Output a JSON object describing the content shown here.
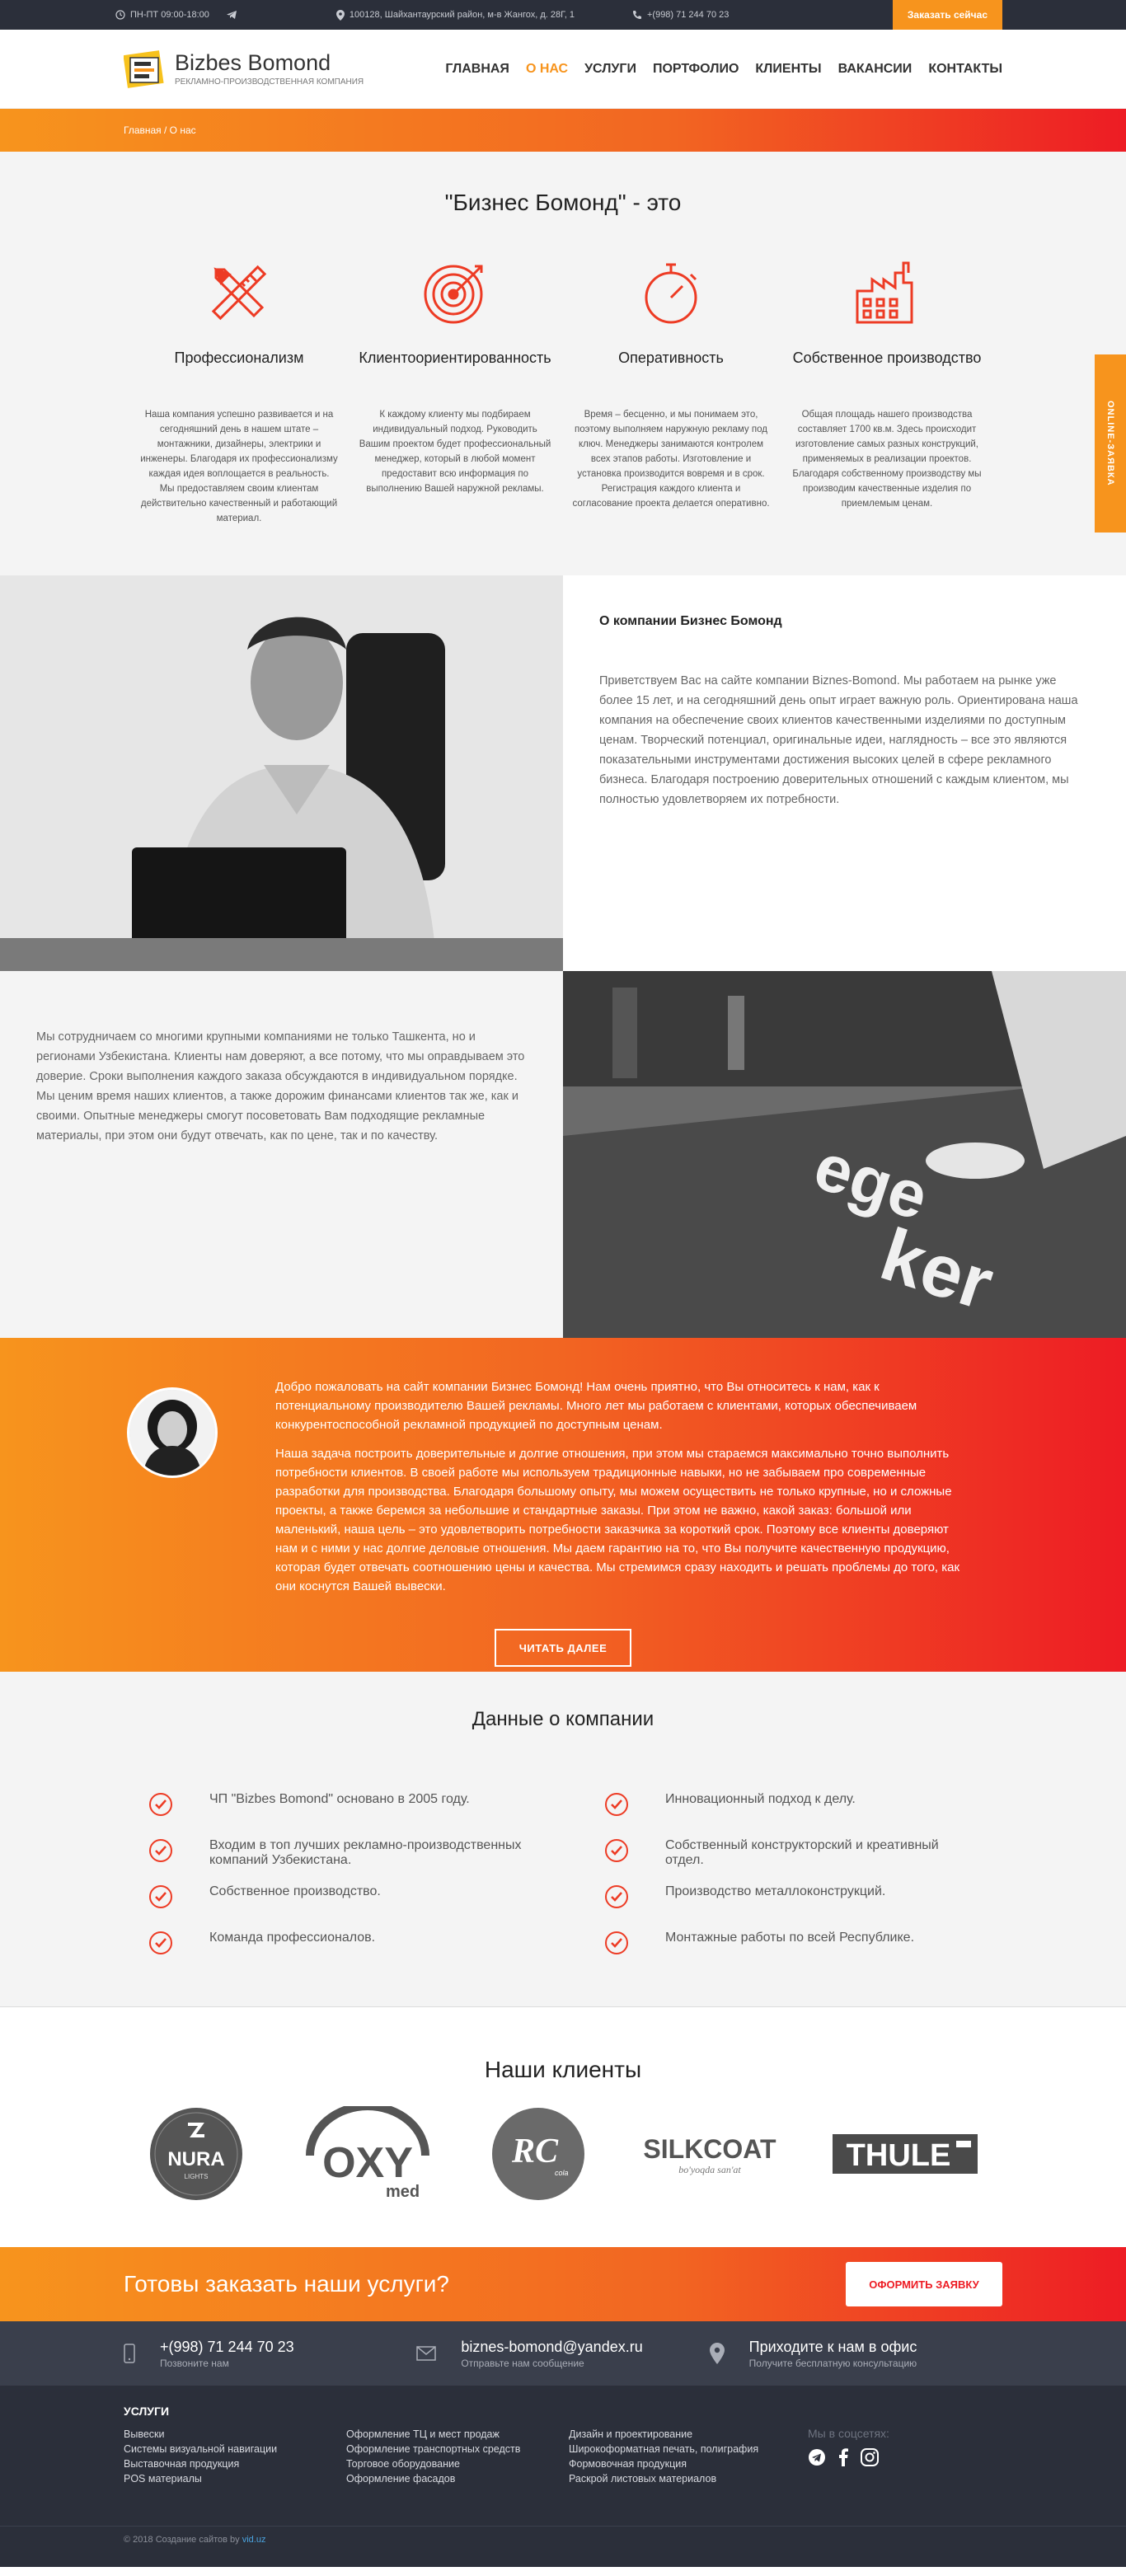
{
  "topbar": {
    "hours": "ПН-ПТ 09:00-18:00",
    "address": "100128, Шайхантаурский район, м-в Жангох, д. 28Г, 1",
    "phone": "+(998) 71 244 70 23",
    "order_btn": "Заказать сейчас"
  },
  "header": {
    "logo_name": "Bizbes Bomond",
    "logo_sub": "РЕКЛАМНО-ПРОИЗВОДСТВЕННАЯ КОМПАНИЯ",
    "nav": [
      "ГЛАВНАЯ",
      "О НАС",
      "УСЛУГИ",
      "ПОРТФОЛИО",
      "КЛИЕНТЫ",
      "ВАКАНСИИ",
      "КОНТАКТЫ"
    ]
  },
  "breadcrumb": "Главная / О нас",
  "online_tab": "ONLINE-ЗАЯВКА",
  "intro": {
    "title": "\"Бизнес Бомонд\" - это",
    "features": [
      {
        "icon": "pencil-ruler-icon",
        "title": "Профессионализм",
        "text": "Наша компания успешно развивается и на сегодняшний день в нашем штате – монтажники, дизайнеры, электрики и инженеры. Благодаря их профессионализму каждая идея воплощается в реальность. Мы предоставляем своим клиентам действительно качественный и работающий материал."
      },
      {
        "icon": "target-icon",
        "title": "Клиентоориентированность",
        "text": "К каждому клиенту мы подбираем индивидуальный подход. Руководить Вашим проектом будет профессиональный менеджер, который в любой момент предоставит всю информация по выполнению Вашей наружной рекламы."
      },
      {
        "icon": "stopwatch-icon",
        "title": "Оперативность",
        "text": "Время – бесценно, и мы понимаем это, поэтому выполняем наружную рекламу под ключ. Менеджеры занимаются контролем всех этапов работы. Изготовление и установка производится вовремя и в срок. Регистрация каждого клиента и согласование проекта делается оперативно."
      },
      {
        "icon": "factory-icon",
        "title": "Собственное производство",
        "text": "Общая площадь нашего производства составляет 1700 кв.м. Здесь происходит изготовление самых разных конструкций, применяемых в реализации проектов. Благодаря собственному производству мы производим качественные изделия по приемлемым ценам."
      }
    ]
  },
  "about": {
    "title": "О компании Бизнес Бомонд",
    "text": "Приветствуем Вас на сайте компании Biznes-Bomond. Мы работаем на рынке уже более 15 лет, и на сегодняшний день опыт играет важную роль. Ориентирована наша компания на обеспечение своих клиентов качественными изделиями по доступным ценам. Творческий потенциал, оригинальные идеи, наглядность – все это являются показательными инструментами достижения высоких целей в сфере рекламного бизнеса. Благодаря построению доверительных отношений с каждым клиентом, мы полностью удовлетворяем их потребности.",
    "text2": "Мы сотрудничаем со многими крупными компаниями не только Ташкента, но и регионами Узбекистана. Клиенты нам доверяют, а все потому, что мы оправдываем это доверие. Сроки выполнения каждого заказа обсуждаются в индивидуальном порядке. Мы ценим время наших клиентов, а также дорожим финансами клиентов так же, как и своими. Опытные менеджеры смогут посоветовать Вам подходящие рекламные материалы, при этом они будут отвечать, как по цене, так и по качеству."
  },
  "welcome": {
    "p1": "Добро пожаловать на сайт компании Бизнес Бомонд! Нам очень приятно, что Вы относитесь к нам, как к потенциальному производителю Вашей рекламы. Много лет мы работаем с клиентами, которых обеспечиваем конкурентоспособной рекламной продукцией по доступным ценам.",
    "p2": "Наша задача построить доверительные и долгие отношения, при этом мы стараемся максимально точно выполнить потребности клиентов. В своей работе мы используем традиционные навыки, но не забываем про современные разработки для производства. Благодаря большому опыту, мы можем осуществить не только крупные, но и сложные проекты, а также беремся за небольшие и стандартные заказы. При этом не важно, какой заказ: большой или маленький, наша цель – это удовлетворить потребности заказчика за короткий срок. Поэтому все клиенты доверяют нам и с ними у нас долгие деловые отношения. Мы даем гарантию на то, что Вы получите качественную продукцию, которая будет отвечать соотношению цены и качества. Мы стремимся сразу находить и решать проблемы до того, как они коснутся Вашей вывески.",
    "button": "ЧИТАТЬ ДАЛЕЕ"
  },
  "company_data": {
    "title": "Данные о компании",
    "left": [
      "ЧП \"Bizbes Bomond\" основано в 2005 году.",
      "Входим в топ лучших рекламно-производственных компаний Узбекистана.",
      "Собственное производство.",
      "Команда профессионалов."
    ],
    "right": [
      "Инновационный подход к делу.",
      "Собственный конструкторский и креативный отдел.",
      "Производство металлоконструкций.",
      "Монтажные работы по всей Республике."
    ]
  },
  "clients": {
    "title": "Наши клиенты",
    "logos": [
      "NURA",
      "LIGHTS",
      "OXY",
      "med",
      "RC",
      "cola",
      "SILKCOAT",
      "bo'yoqda san'at",
      "THULE"
    ]
  },
  "cta": {
    "title": "Готовы заказать наши услуги?",
    "button": "ОФОРМИТЬ ЗАЯВКУ"
  },
  "contacts": [
    {
      "icon": "phone-icon",
      "main": "+(998) 71 244 70 23",
      "sub": "Позвоните нам"
    },
    {
      "icon": "mail-icon",
      "main": "biznes-bomond@yandex.ru",
      "sub": "Отправьте нам сообщение"
    },
    {
      "icon": "location-icon",
      "main": "Приходите к нам в офис",
      "sub": "Получите бесплатную консультацию"
    }
  ],
  "footer": {
    "services_title": "УСЛУГИ",
    "col1": [
      "Вывески",
      "Системы визуальной навигации",
      "Выставочная продукция",
      "POS материалы"
    ],
    "col2": [
      "Оформление ТЦ и мест продаж",
      "Оформление транспортных средств",
      "Торговое оборудование",
      "Оформление фасадов"
    ],
    "col3": [
      "Дизайн и проектирование",
      "Широкоформатная печать, полиграфия",
      "Формовочная продукция",
      "Раскрой листовых материалов"
    ],
    "social_label": "Мы в соцсетях:",
    "copyright": "© 2018 Создание сайтов by",
    "copyright_link": "vid.uz"
  },
  "colors": {
    "accent": "#f7941d",
    "red": "#ed1c24",
    "dark": "#2b2f3a"
  }
}
